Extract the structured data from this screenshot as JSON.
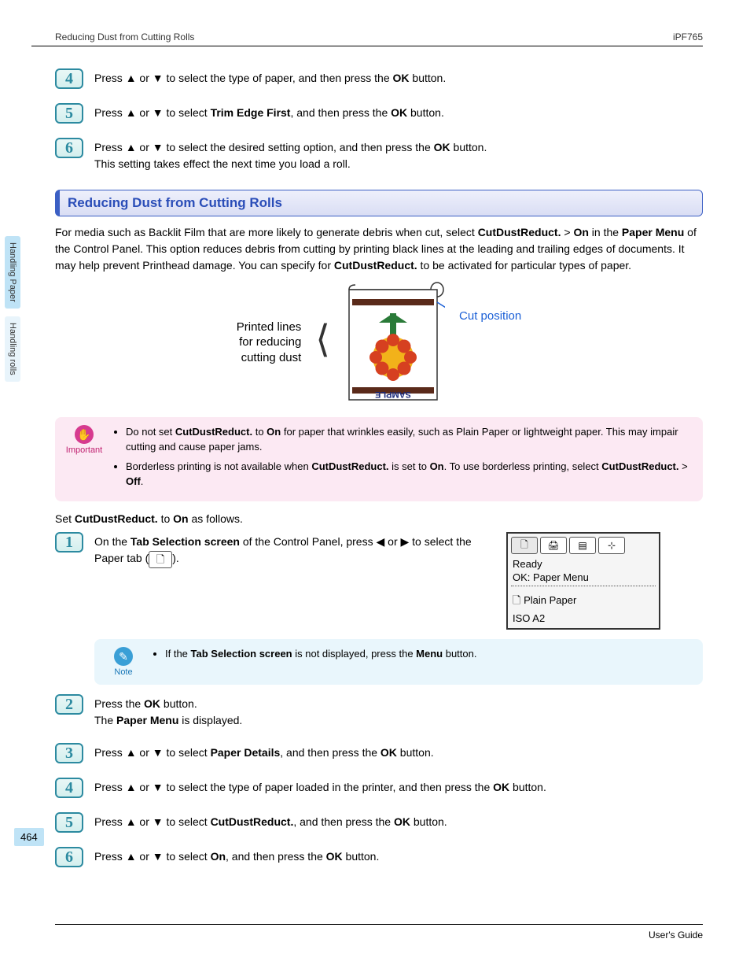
{
  "header": {
    "left": "Reducing Dust from Cutting Rolls",
    "right": "iPF765"
  },
  "sideTabs": {
    "l1": "Handling Paper",
    "l2": "Handling rolls"
  },
  "triUp": "▲",
  "triDown": "▼",
  "triLeft": "◀",
  "triRight": "▶",
  "topSteps": {
    "s4": {
      "num": "4",
      "pre": "Press ",
      "mid": " or ",
      "post": " to select the type of paper, and then press the ",
      "btn": "OK",
      "end": " button."
    },
    "s5": {
      "num": "5",
      "pre": "Press ",
      "mid": " or ",
      "sel": " to select ",
      "opt": "Trim Edge First",
      "post": ", and then press the ",
      "btn": "OK",
      "end": " button."
    },
    "s6": {
      "num": "6",
      "l1pre": "Press ",
      "l1mid": " or ",
      "l1post": " to select the desired setting option, and then press the ",
      "l1btn": "OK",
      "l1end": " button.",
      "l2": "This setting takes effect the next time you load a roll."
    }
  },
  "section": {
    "title": "Reducing Dust from Cutting Rolls"
  },
  "intro": {
    "t1": "For media such as Backlit Film that are more likely to generate debris when cut, select ",
    "b1": "CutDustReduct.",
    "t2": " > ",
    "b2": "On",
    "t3": " in the ",
    "b3": "Paper Menu",
    "t4": " of the Control Panel. This option reduces debris from cutting by printing black lines at the leading and trailing edges of documents. It may help prevent Printhead damage. You can specify for ",
    "b4": "CutDustReduct.",
    "t5": " to be activated for particular types of paper."
  },
  "diagram": {
    "left1": "Printed lines",
    "left2": "for reducing",
    "left3": "cutting dust",
    "right": "Cut position",
    "sample": "SAMPLE"
  },
  "important": {
    "label": "Important",
    "b1a": "Do not set ",
    "b1b": "CutDustReduct.",
    "b1c": " to ",
    "b1d": "On",
    "b1e": " for paper that wrinkles easily, such as Plain Paper or lightweight paper. This may impair cutting and cause paper jams.",
    "b2a": "Borderless printing is not available when ",
    "b2b": "CutDustReduct.",
    "b2c": " is set to ",
    "b2d": "On",
    "b2e": ". To use borderless printing, select ",
    "b2f": "CutDustReduct.",
    "b2g": " > ",
    "b2h": "Off",
    "b2i": "."
  },
  "setline": {
    "t1": "Set ",
    "b1": "CutDustReduct.",
    "t2": " to ",
    "b2": "On",
    "t3": " as follows."
  },
  "step1": {
    "num": "1",
    "t1": "On the ",
    "b1": "Tab Selection screen",
    "t2": " of the Control Panel, press ",
    "t3": " or ",
    "t4": " to select the Paper tab (",
    "t5": ")."
  },
  "screen": {
    "ready": "Ready",
    "okmenu": "OK: Paper Menu",
    "paper": "Plain Paper",
    "size": "   ISO A2"
  },
  "note": {
    "label": "Note",
    "t1": "If the ",
    "b1": "Tab Selection screen",
    "t2": " is not displayed, press the ",
    "b2": "Menu",
    "t3": " button."
  },
  "steps": {
    "s2": {
      "num": "2",
      "t1": "Press the ",
      "b1": "OK",
      "t2": " button.",
      "t3": "The ",
      "b2": "Paper Menu",
      "t4": " is displayed."
    },
    "s3": {
      "num": "3",
      "pre": "Press ",
      "mid": " or ",
      "sel": " to select ",
      "opt": "Paper Details",
      "post": ", and then press the ",
      "btn": "OK",
      "end": " button."
    },
    "s4": {
      "num": "4",
      "pre": "Press ",
      "mid": " or ",
      "post": " to select the type of paper loaded in the printer, and then press the ",
      "btn": "OK",
      "end": " button."
    },
    "s5": {
      "num": "5",
      "pre": "Press ",
      "mid": " or ",
      "sel": " to select ",
      "opt": "CutDustReduct.",
      "post": ", and then press the ",
      "btn": "OK",
      "end": " button."
    },
    "s6": {
      "num": "6",
      "pre": "Press ",
      "mid": " or ",
      "sel": " to select ",
      "opt": "On",
      "post": ", and then press the ",
      "btn": "OK",
      "end": " button."
    }
  },
  "pageNumber": "464",
  "footer": "User's Guide"
}
